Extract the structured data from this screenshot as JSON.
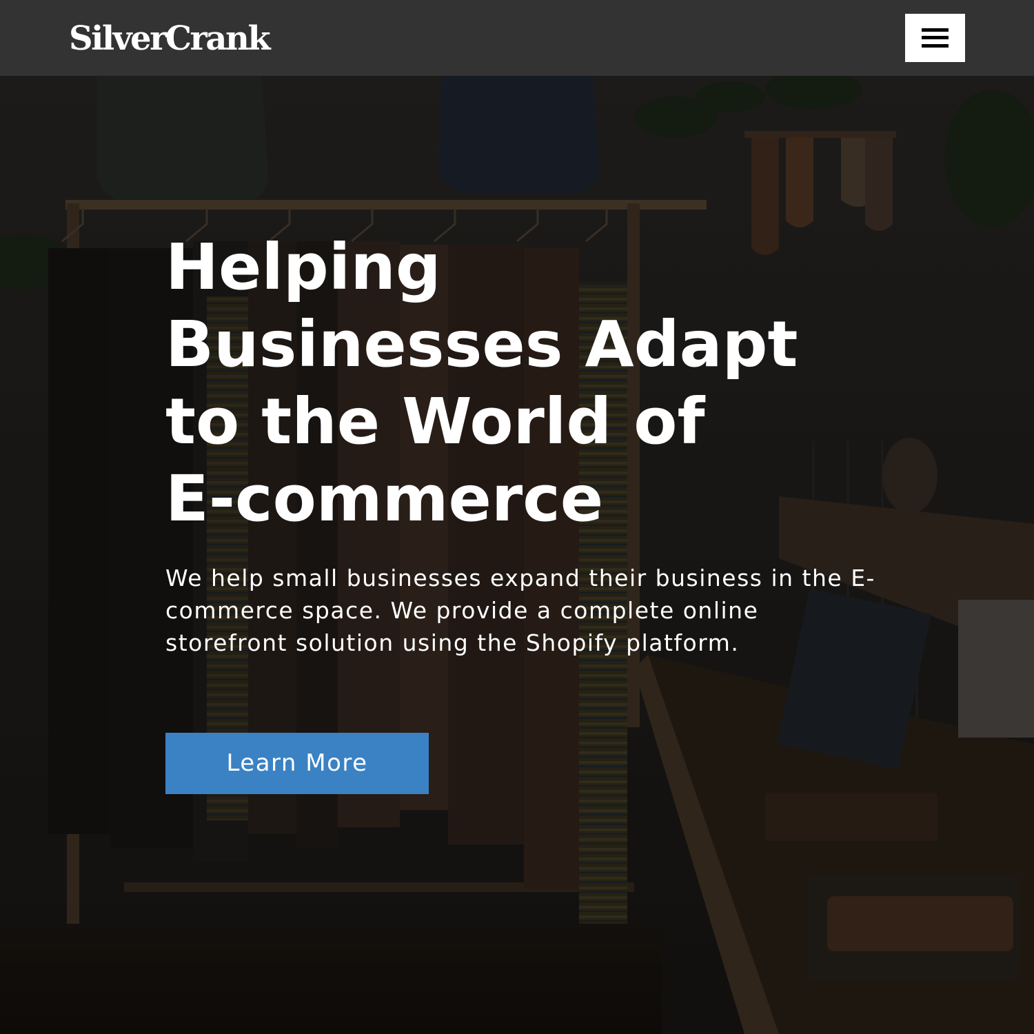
{
  "header": {
    "logo_text": "SilverCrank",
    "menu_icon": "hamburger-menu-icon"
  },
  "hero": {
    "title_lines": [
      "Helping",
      "Businesses Adapt",
      "to the World of",
      "E-commerce"
    ],
    "description": "We help small businesses expand their business in the E-commerce space. We provide a complete online storefront solution using the Shopify platform.",
    "cta_label": "Learn More",
    "background_image": "clothing-store-interior"
  },
  "colors": {
    "header_bg": "#333333",
    "button_bg": "#3a82c4",
    "text": "#ffffff",
    "menu_button_bg": "#ffffff"
  }
}
